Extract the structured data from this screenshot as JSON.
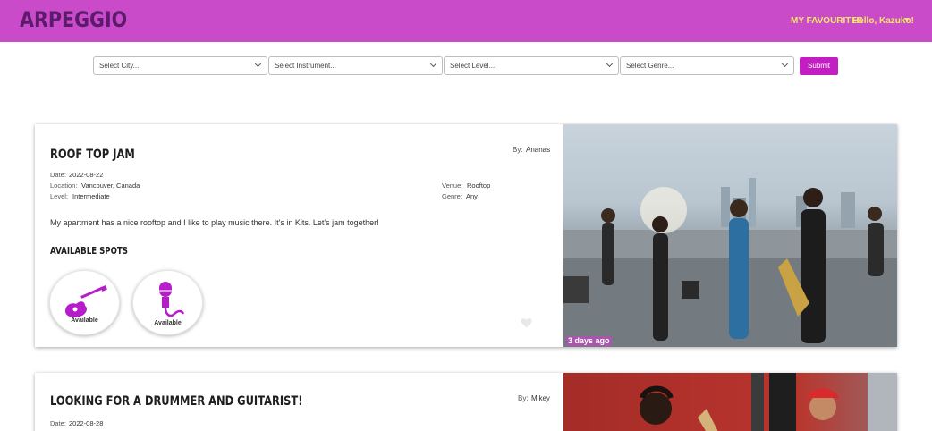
{
  "navbar": {
    "brand": "ARPEGGIO",
    "favourites_label": "MY FAVOURITES",
    "user_greeting": "Hello, Kazuko!"
  },
  "filters": {
    "city_placeholder": "Select City...",
    "instrument_placeholder": "Select Instrument...",
    "level_placeholder": "Select Level...",
    "genre_placeholder": "Select Genre...",
    "submit_label": "Submit"
  },
  "listings": [
    {
      "title": "ROOF TOP JAM",
      "by_label": "By:",
      "by": "Ananas",
      "date_label": "Date:",
      "date": "2022-08-22",
      "location_label": "Location:",
      "location": "Vancouver, Canada",
      "level_label": "Level:",
      "level": "Intermediate",
      "venue_label": "Venue:",
      "venue": "Rooftop",
      "genre_label": "Genre:",
      "genre": "Any",
      "description": "My apartment has a nice rooftop and I like to play music there. It's in Kits. Let's jam together!",
      "spots_heading": "AVAILABLE SPOTS",
      "spots": [
        {
          "instrument": "guitar-icon",
          "status": "Available"
        },
        {
          "instrument": "microphone-icon",
          "status": "Available"
        }
      ],
      "posted": "3 days ago"
    },
    {
      "title": "LOOKING FOR A DRUMMER AND GUITARIST!",
      "by_label": "By:",
      "by": "Mikey",
      "date_label": "Date:",
      "date": "2022-08-28"
    }
  ],
  "colors": {
    "navbar": "#c94bc9",
    "brand": "#5c1a6b",
    "nav_link": "#f5e86a",
    "accent": "#c21ec2",
    "icon_purple": "#b61cc9"
  }
}
